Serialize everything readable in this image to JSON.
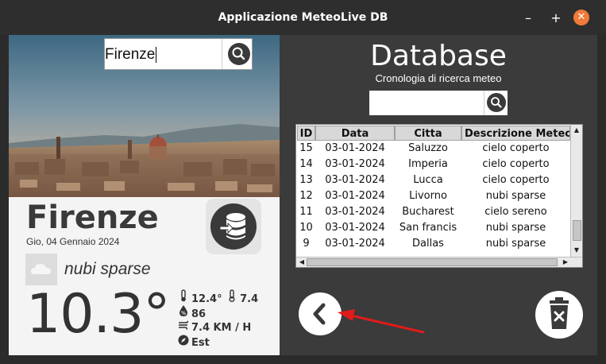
{
  "window": {
    "title": "Applicazione MeteoLive DB",
    "controls": {
      "minimize": "–",
      "maximize": "+",
      "close": "✕"
    }
  },
  "search": {
    "value": "Firenze",
    "icon": "search-icon"
  },
  "weather": {
    "city": "Firenze",
    "date": "Gio, 04 Gennaio 2024",
    "description": "nubi sparse",
    "temperature": "10.3°",
    "temp_max": "12.4",
    "temp_min": "7.4",
    "humidity": "86",
    "wind": "7.4 KM / H",
    "wind_direction": "Est"
  },
  "database": {
    "title": "Database",
    "subtitle": "Cronologia di ricerca meteo",
    "search_value": "",
    "columns": [
      "ID",
      "Data",
      "Citta",
      "Descrizione Meteo"
    ],
    "rows": [
      [
        "15",
        "03-01-2024",
        "Saluzzo",
        "cielo coperto"
      ],
      [
        "14",
        "03-01-2024",
        "Imperia",
        "cielo coperto"
      ],
      [
        "13",
        "03-01-2024",
        "Lucca",
        "cielo coperto"
      ],
      [
        "12",
        "03-01-2024",
        "Livorno",
        "nubi sparse"
      ],
      [
        "11",
        "03-01-2024",
        "Bucharest",
        "cielo sereno"
      ],
      [
        "10",
        "03-01-2024",
        "San francis",
        "nubi sparse"
      ],
      [
        "9",
        "03-01-2024",
        "Dallas",
        "nubi sparse"
      ]
    ]
  },
  "colors": {
    "panel_dark": "#3b3b3b",
    "accent_close": "#f07a3a",
    "annotation_arrow": "#e01b1b"
  }
}
